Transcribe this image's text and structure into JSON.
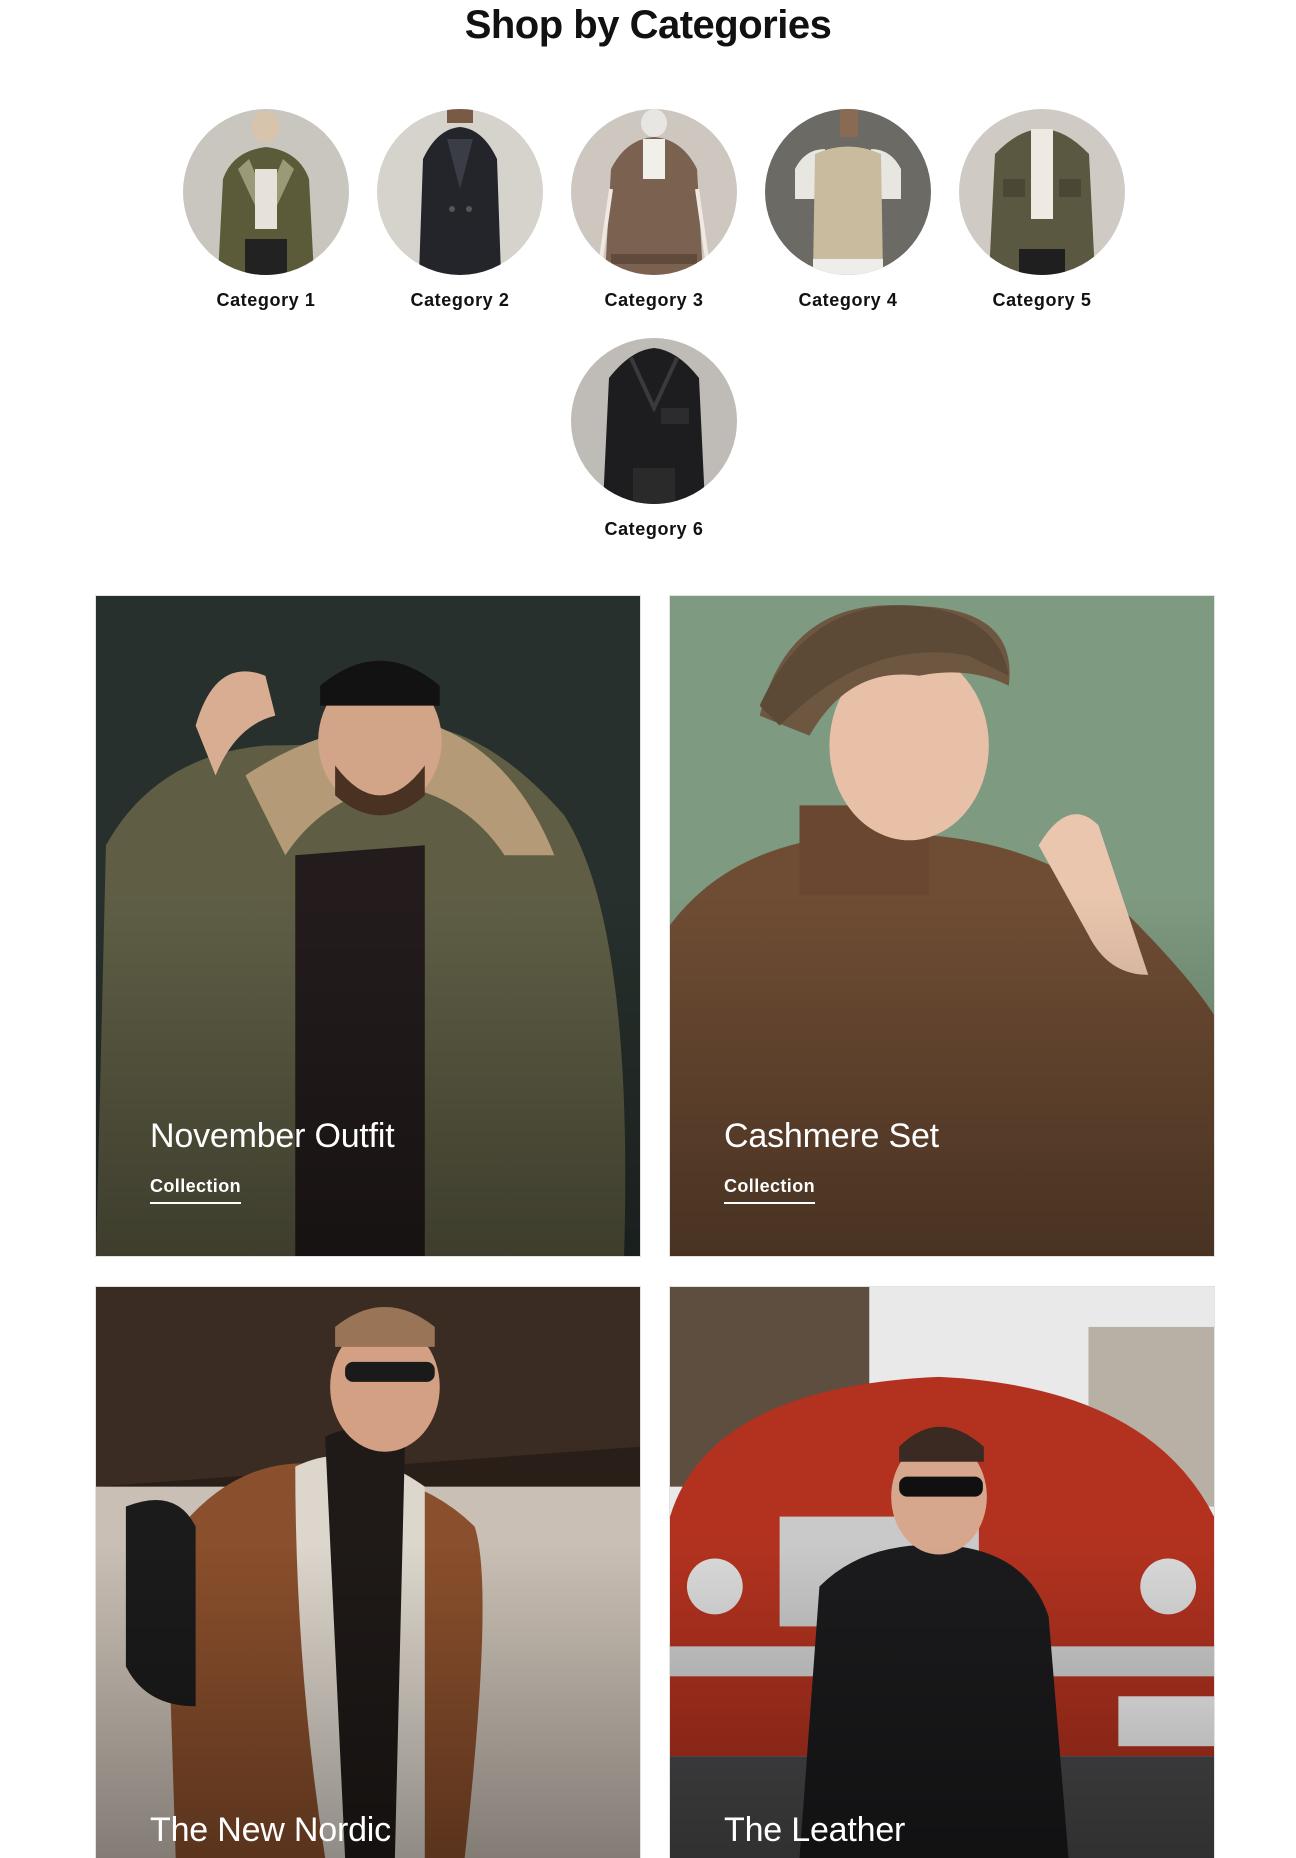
{
  "section": {
    "title": "Shop by Categories"
  },
  "categories": [
    {
      "label": "Category 1",
      "icon": "olive-colorblock-jacket-image"
    },
    {
      "label": "Category 2",
      "icon": "black-trench-coat-image"
    },
    {
      "label": "Category 3",
      "icon": "brown-bomber-jacket-image"
    },
    {
      "label": "Category 4",
      "icon": "knit-vest-image"
    },
    {
      "label": "Category 5",
      "icon": "quilted-olive-jacket-image"
    },
    {
      "label": "Category 6",
      "icon": "black-leather-jacket-image"
    }
  ],
  "collections": [
    {
      "title": "November Outfit",
      "link": "Collection",
      "bg": "#2d352e"
    },
    {
      "title": "Cashmere Set",
      "link": "Collection",
      "bg": "#7f9a7e"
    },
    {
      "title": "The New Nordic",
      "bg": "#3d2a1e"
    },
    {
      "title": "The Leather",
      "bg": "#b63524"
    }
  ]
}
